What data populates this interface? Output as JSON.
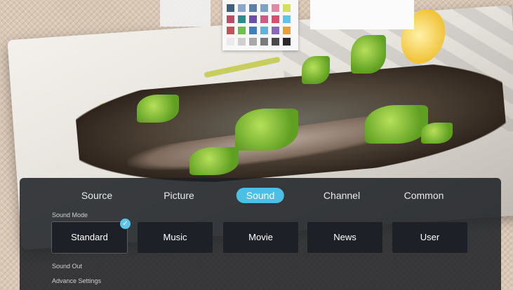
{
  "background": {
    "swatch_colors": [
      "#3f5f7a",
      "#89a8c8",
      "#5d7fa6",
      "#7ea2c4",
      "#e488a5",
      "#d4e05a",
      "#b94d65",
      "#2f8a8a",
      "#6a4fa7",
      "#d05b87",
      "#d94d6d",
      "#60c4e4",
      "#c8505a",
      "#6fbf4a",
      "#3f7fc0",
      "#5ab5d8",
      "#8a68c2",
      "#e8a030",
      "#eaeaea",
      "#d0d0d0",
      "#a8a8a8",
      "#7a7a7a",
      "#4a4a4a",
      "#2a2a2a"
    ]
  },
  "tabs": [
    {
      "label": "Source",
      "active": false
    },
    {
      "label": "Picture",
      "active": false
    },
    {
      "label": "Sound",
      "active": true
    },
    {
      "label": "Channel",
      "active": false
    },
    {
      "label": "Common",
      "active": false
    }
  ],
  "sound_mode": {
    "label": "Sound Mode",
    "options": [
      "Standard",
      "Music",
      "Movie",
      "News",
      "User"
    ],
    "selected": "Standard"
  },
  "sound_out": {
    "label": "Sound Out"
  },
  "advance_settings": {
    "label": "Advance Settings"
  },
  "colors": {
    "accent": "#4cc0e4",
    "panel": "#1c1f24"
  }
}
